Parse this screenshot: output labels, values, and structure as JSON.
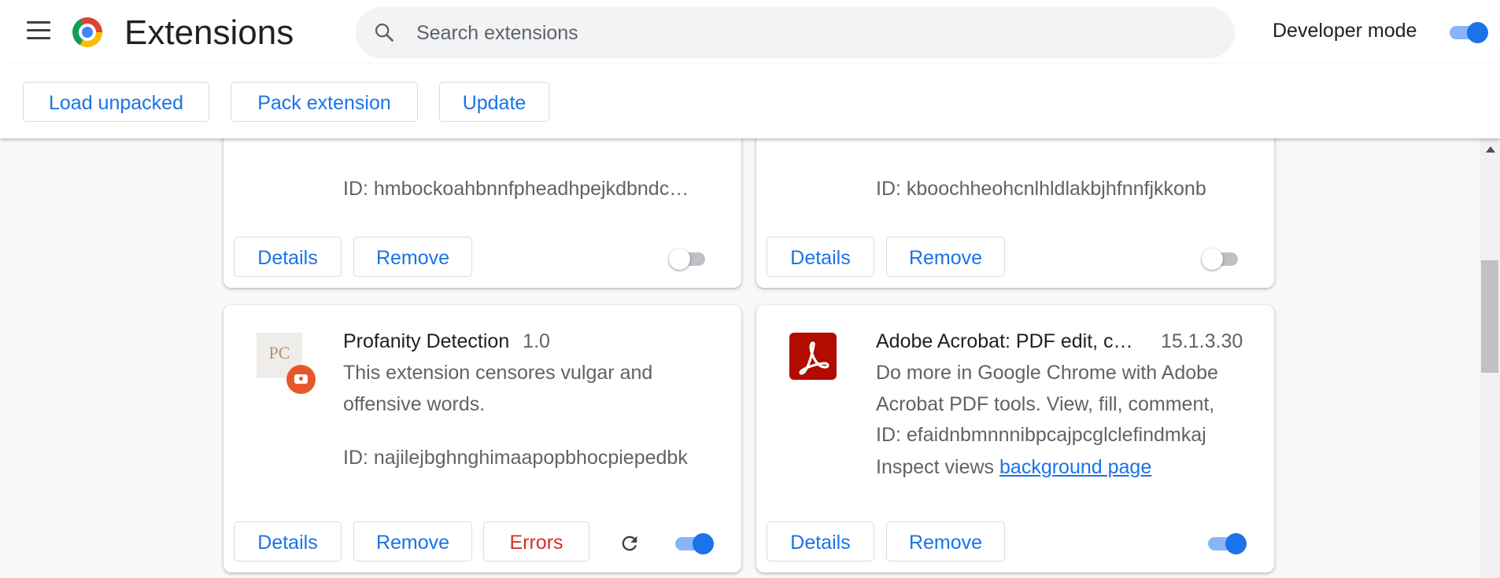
{
  "header": {
    "title": "Extensions",
    "search_placeholder": "Search extensions",
    "developer_mode_label": "Developer mode",
    "developer_mode_on": true
  },
  "toolbar": {
    "load_unpacked": "Load unpacked",
    "pack_extension": "Pack extension",
    "update": "Update"
  },
  "extensions": [
    {
      "id_text": "ID: hmbockoahbnnfpheadhpejkdbndc…",
      "details": "Details",
      "remove": "Remove",
      "enabled": false
    },
    {
      "id_text": "ID: kboochheohcnlhldlakbjhfnnfjkkonb",
      "details": "Details",
      "remove": "Remove",
      "enabled": false
    },
    {
      "name": "Profanity Detection",
      "version": "1.0",
      "desc_line1": "This extension censores vulgar and",
      "desc_line2": "offensive words.",
      "icon_text": "PC",
      "id_text": "ID: najilejbghnghimaapopbhocpiepedbk",
      "details": "Details",
      "remove": "Remove",
      "errors": "Errors",
      "enabled": true
    },
    {
      "name": "Adobe Acrobat: PDF edit, c…",
      "version": "15.1.3.30",
      "desc_line1": "Do more in Google Chrome with Adobe",
      "desc_line2": "Acrobat PDF tools. View, fill, comment,",
      "id_text": "ID: efaidnbmnnnibpcajpcglclefindmkaj",
      "inspect_label": "Inspect views",
      "inspect_link": "background page",
      "details": "Details",
      "remove": "Remove",
      "enabled": true
    }
  ],
  "colors": {
    "accent": "#1a73e8",
    "error": "#d93025",
    "adobe_red": "#b30b00",
    "badge_orange": "#e8572c"
  }
}
